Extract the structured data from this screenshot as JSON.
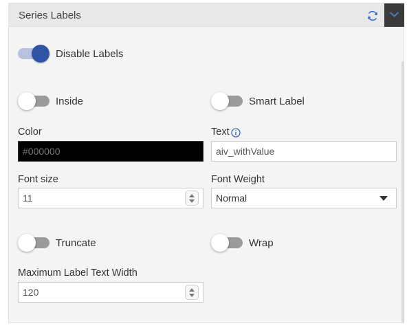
{
  "header": {
    "title": "Series Labels"
  },
  "disable_labels": {
    "label": "Disable Labels",
    "on": true
  },
  "inside": {
    "label": "Inside",
    "on": false
  },
  "smart_label": {
    "label": "Smart Label",
    "on": false
  },
  "color": {
    "label": "Color",
    "value": "#000000"
  },
  "text": {
    "label": "Text",
    "value": "aiv_withValue"
  },
  "font_size": {
    "label": "Font size",
    "value": "11"
  },
  "font_weight": {
    "label": "Font Weight",
    "value": "Normal"
  },
  "truncate": {
    "label": "Truncate",
    "on": false
  },
  "wrap": {
    "label": "Wrap",
    "on": false
  },
  "max_width": {
    "label": "Maximum Label Text Width",
    "value": "120"
  },
  "colors": {
    "accent": "#2f55a4",
    "toggle_off": "#9b9b9b",
    "header_bg": "#e8e8e8",
    "panel_bg": "#f4f4f4"
  }
}
